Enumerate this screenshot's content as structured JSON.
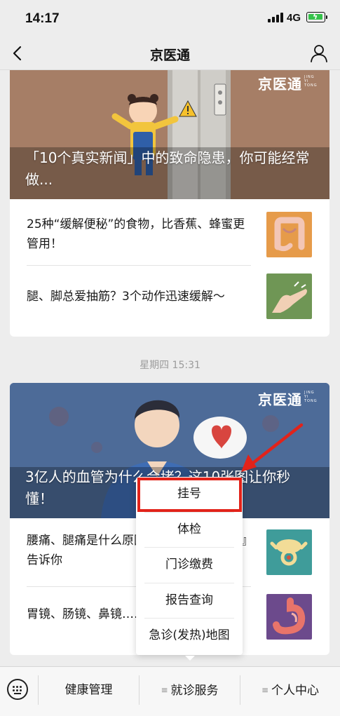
{
  "status_bar": {
    "time": "14:17",
    "network": "4G",
    "battery_color": "#35c24a"
  },
  "nav": {
    "title": "京医通",
    "back_icon": "chevron-left-icon",
    "profile_icon": "person-icon"
  },
  "articles": [
    {
      "cover_title": "「10个真实新闻」中的致命隐患，你可能经常做...",
      "brand": "京医通",
      "items": [
        {
          "title": "25种“缓解便秘”的食物，比香蕉、蜂蜜更管用！",
          "thumb_icon": "intestine-icon"
        },
        {
          "title": "腿、脚总爱抽筋？3个动作迅速缓解～",
          "thumb_icon": "foot-cramp-icon"
        }
      ]
    },
    {
      "cover_title": "3亿人的血管为什么会堵？这10张图让你秒懂！",
      "brand": "京医通",
      "items": [
        {
          "title": "腰痛、腿痛是什么原因？这一块『羊蝎子』告诉你",
          "thumb_icon": "vertebra-icon"
        },
        {
          "title": "胃镜、肠镜、鼻镜……检查前要查",
          "thumb_icon": "stomach-icon"
        }
      ]
    }
  ],
  "timestamp": "星期四 15:31",
  "popup_menu": {
    "items": [
      "挂号",
      "体检",
      "门诊缴费",
      "报告查询",
      "急诊(发热)地图"
    ],
    "highlight_color": "#e2231a"
  },
  "bottom_menu": {
    "keyboard_icon": "keyboard-icon",
    "items": [
      "健康管理",
      "就诊服务",
      "个人中心"
    ]
  }
}
